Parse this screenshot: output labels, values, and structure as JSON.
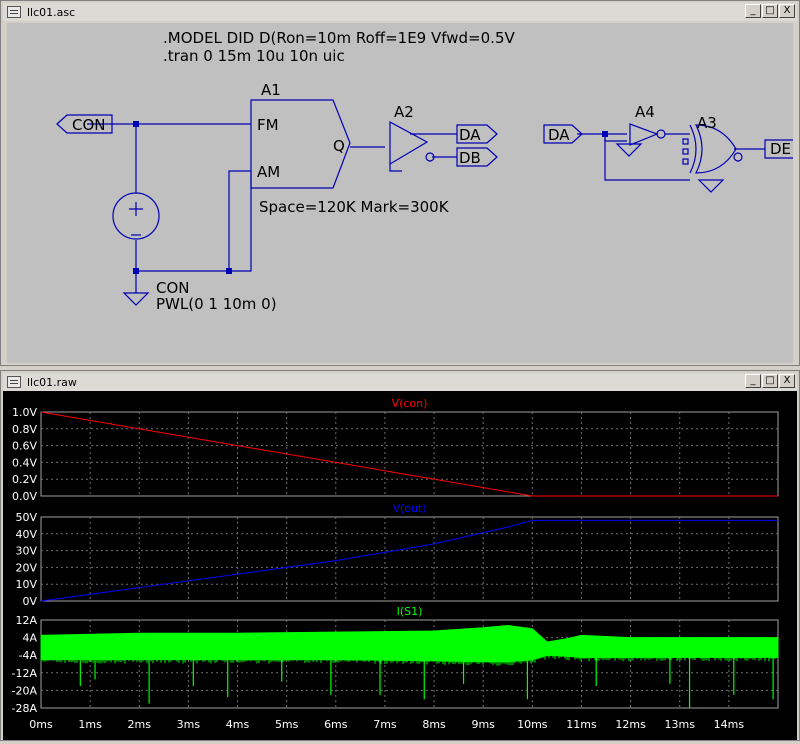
{
  "schematic_window": {
    "title": "llc01.asc",
    "buttons": {
      "minimize": "_",
      "maximize": "□",
      "close": "X"
    }
  },
  "schematic": {
    "directives": [
      ".MODEL DID D(Ron=10m Roff=1E9 Vfwd=0.5V",
      ".tran 0 15m 10u 10n uic"
    ],
    "labels": {
      "con_port": "CON",
      "a1": "A1",
      "fm": "FM",
      "am": "AM",
      "q": "Q",
      "a2": "A2",
      "da_out": "DA",
      "db_out": "DB",
      "da_in": "DA",
      "a4": "A4",
      "a3": "A3",
      "de_out": "DE",
      "params": "Space=120K Mark=300K",
      "source_name": "CON",
      "source_value": "PWL(0 1 10m 0)"
    }
  },
  "waveform_window": {
    "title": "llc01.raw",
    "buttons": {
      "minimize": "_",
      "maximize": "□",
      "close": "X"
    }
  },
  "chart_data": [
    {
      "type": "line",
      "title": "V(con)",
      "color": "#ff0000",
      "ylim": [
        0,
        1.0
      ],
      "yticks": [
        "1.0V",
        "0.8V",
        "0.6V",
        "0.4V",
        "0.2V",
        "0.0V"
      ],
      "x": [
        0,
        10,
        15
      ],
      "y": [
        1.0,
        0.0,
        0.0
      ]
    },
    {
      "type": "line",
      "title": "V(out)",
      "color": "#0000ff",
      "ylim": [
        0,
        50
      ],
      "yticks": [
        "50V",
        "40V",
        "30V",
        "20V",
        "10V",
        "0V"
      ],
      "x": [
        0,
        2,
        4,
        6,
        8,
        9.5,
        10,
        10.3,
        15
      ],
      "y": [
        0,
        8,
        16,
        24,
        34,
        44,
        48,
        48,
        48
      ]
    },
    {
      "type": "area",
      "title": "I(S1)",
      "color": "#00ff00",
      "ylim": [
        -28,
        12
      ],
      "yticks": [
        "12A",
        "4A",
        "-4A",
        "-12A",
        "-20A",
        "-28A"
      ],
      "x": [
        0,
        2,
        4,
        6,
        8,
        9,
        9.5,
        10,
        10.3,
        10.7,
        11,
        12,
        15
      ],
      "y_upper": [
        5,
        6,
        6,
        6.5,
        7,
        8.5,
        9.5,
        8,
        2,
        3.5,
        5,
        4,
        4
      ],
      "y_lower": [
        -6,
        -6,
        -6,
        -6,
        -6.5,
        -7,
        -7,
        -6,
        -4,
        -4.5,
        -5,
        -5,
        -5
      ],
      "spikes": [
        {
          "x": 0.8,
          "y": -18
        },
        {
          "x": 1.1,
          "y": -15
        },
        {
          "x": 2.2,
          "y": -26
        },
        {
          "x": 3.1,
          "y": -18
        },
        {
          "x": 3.8,
          "y": -23
        },
        {
          "x": 4.9,
          "y": -16
        },
        {
          "x": 5.9,
          "y": -22
        },
        {
          "x": 6.9,
          "y": -22
        },
        {
          "x": 7.8,
          "y": -24
        },
        {
          "x": 8.6,
          "y": -17
        },
        {
          "x": 9.9,
          "y": -24
        },
        {
          "x": 11.3,
          "y": -18
        },
        {
          "x": 12.8,
          "y": -17
        },
        {
          "x": 13.2,
          "y": -28
        },
        {
          "x": 14.1,
          "y": -22
        },
        {
          "x": 14.9,
          "y": -24
        }
      ]
    }
  ],
  "x_axis": {
    "range": [
      0,
      15
    ],
    "tick_labels": [
      "0ms",
      "1ms",
      "2ms",
      "3ms",
      "4ms",
      "5ms",
      "6ms",
      "7ms",
      "8ms",
      "9ms",
      "10ms",
      "11ms",
      "12ms",
      "13ms",
      "14ms"
    ]
  }
}
